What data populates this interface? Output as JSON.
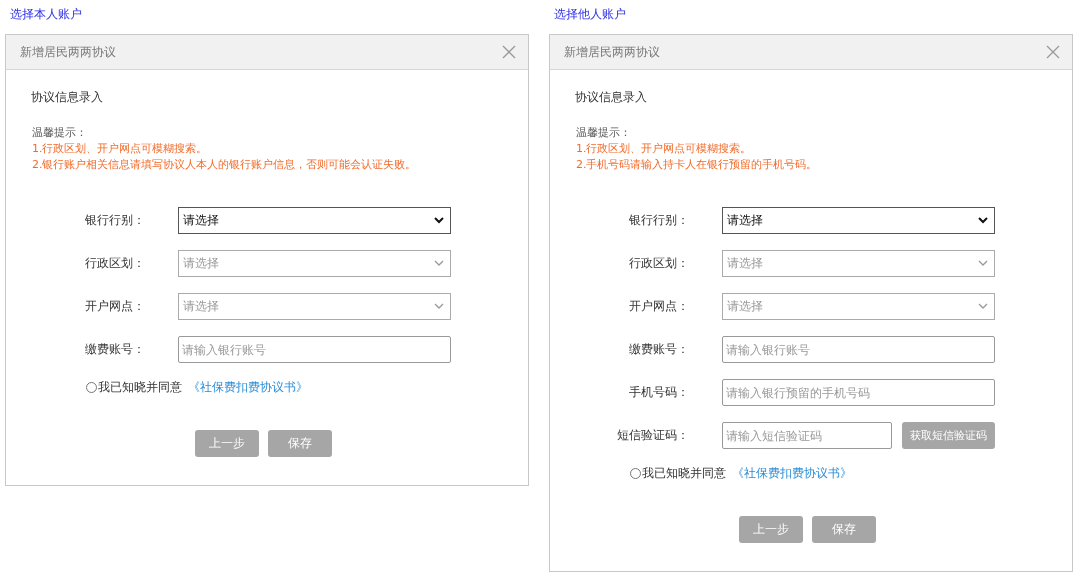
{
  "panels": [
    {
      "heading": "选择本人账户",
      "dialog": {
        "title": "新增居民两两协议",
        "section_title": "协议信息录入",
        "tip_label": "温馨提示：",
        "tips": [
          "1.行政区划、开户网点可模糊搜索。",
          "2.银行账户相关信息请填写协议人本人的银行账户信息，否则可能会认证失败。"
        ],
        "fields": [
          {
            "kind": "select",
            "label": "银行行别：",
            "value": "请选择",
            "disabled": false
          },
          {
            "kind": "select",
            "label": "行政区划：",
            "value": "请选择",
            "disabled": true
          },
          {
            "kind": "select",
            "label": "开户网点：",
            "value": "请选择",
            "disabled": true
          },
          {
            "kind": "input",
            "label": "缴费账号：",
            "placeholder": "请输入银行账号"
          }
        ],
        "agreement": {
          "checked": false,
          "text": "我已知晓并同意",
          "link": "《社保费扣费协议书》"
        },
        "buttons": [
          {
            "label": "上一步",
            "disabled": true
          },
          {
            "label": "保存",
            "disabled": true
          }
        ]
      }
    },
    {
      "heading": "选择他人账户",
      "dialog": {
        "title": "新增居民两两协议",
        "section_title": "协议信息录入",
        "tip_label": "温馨提示：",
        "tips": [
          "1.行政区划、开户网点可模糊搜索。",
          "2.手机号码请输入持卡人在银行预留的手机号码。"
        ],
        "fields": [
          {
            "kind": "select",
            "label": "银行行别：",
            "value": "请选择",
            "disabled": false
          },
          {
            "kind": "select",
            "label": "行政区划：",
            "value": "请选择",
            "disabled": true
          },
          {
            "kind": "select",
            "label": "开户网点：",
            "value": "请选择",
            "disabled": true
          },
          {
            "kind": "input",
            "label": "缴费账号：",
            "placeholder": "请输入银行账号"
          },
          {
            "kind": "input",
            "label": "手机号码：",
            "placeholder": "请输入银行预留的手机号码"
          },
          {
            "kind": "sms",
            "label": "短信验证码：",
            "placeholder": "请输入短信验证码",
            "button": {
              "label": "获取短信验证码",
              "disabled": true
            }
          }
        ],
        "agreement": {
          "checked": false,
          "text": "我已知晓并同意",
          "link": "《社保费扣费协议书》"
        },
        "buttons": [
          {
            "label": "上一步",
            "disabled": true
          },
          {
            "label": "保存",
            "disabled": true
          }
        ]
      }
    }
  ]
}
